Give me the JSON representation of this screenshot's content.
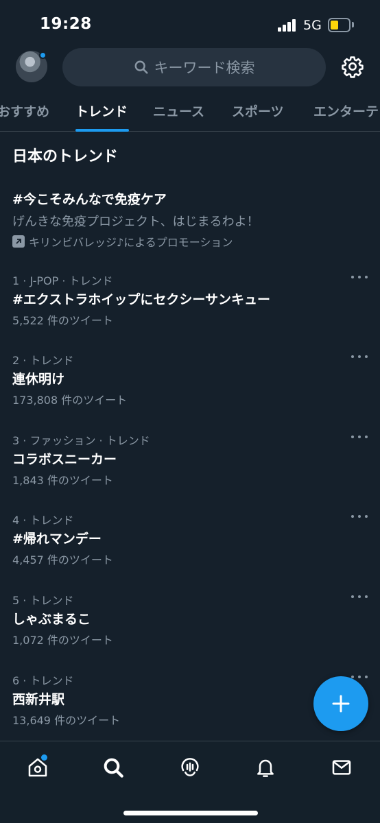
{
  "status_bar": {
    "time": "19:28",
    "network": "5G"
  },
  "search": {
    "placeholder": "キーワード検索"
  },
  "tabs": [
    {
      "label": "おすすめ",
      "active": false
    },
    {
      "label": "トレンド",
      "active": true
    },
    {
      "label": "ニュース",
      "active": false
    },
    {
      "label": "スポーツ",
      "active": false
    },
    {
      "label": "エンターテ",
      "active": false
    }
  ],
  "section_title": "日本のトレンド",
  "promo": {
    "title": "#今こそみんなで免疫ケア",
    "description": "げんきな免疫プロジェクト、はじまるわよ！",
    "by": "キリンビバレッジ♪によるプロモーション"
  },
  "trends": [
    {
      "meta": "1 · J-POP · トレンド",
      "name": "#エクストラホイップにセクシーサンキュー",
      "count": "5,522 件のツイート"
    },
    {
      "meta": "2 · トレンド",
      "name": "連休明け",
      "count": "173,808 件のツイート"
    },
    {
      "meta": "3 · ファッション · トレンド",
      "name": "コラボスニーカー",
      "count": "1,843 件のツイート"
    },
    {
      "meta": "4 · トレンド",
      "name": "#帰れマンデー",
      "count": "4,457 件のツイート"
    },
    {
      "meta": "5 · トレンド",
      "name": "しゃぶまるこ",
      "count": "1,072 件のツイート"
    },
    {
      "meta": "6 · トレンド",
      "name": "西新井駅",
      "count": "13,649 件のツイート"
    }
  ],
  "icons": {
    "search": "search-icon",
    "settings": "gear-icon",
    "more": "more-icon",
    "compose": "plus-icon",
    "home": "home-icon",
    "explore": "search-icon",
    "spaces": "spaces-icon",
    "notifications": "bell-icon",
    "messages": "mail-icon"
  },
  "colors": {
    "background": "#15202b",
    "accent": "#1d9bf0",
    "secondary_text": "#8b98a5",
    "search_bg": "#273340"
  }
}
